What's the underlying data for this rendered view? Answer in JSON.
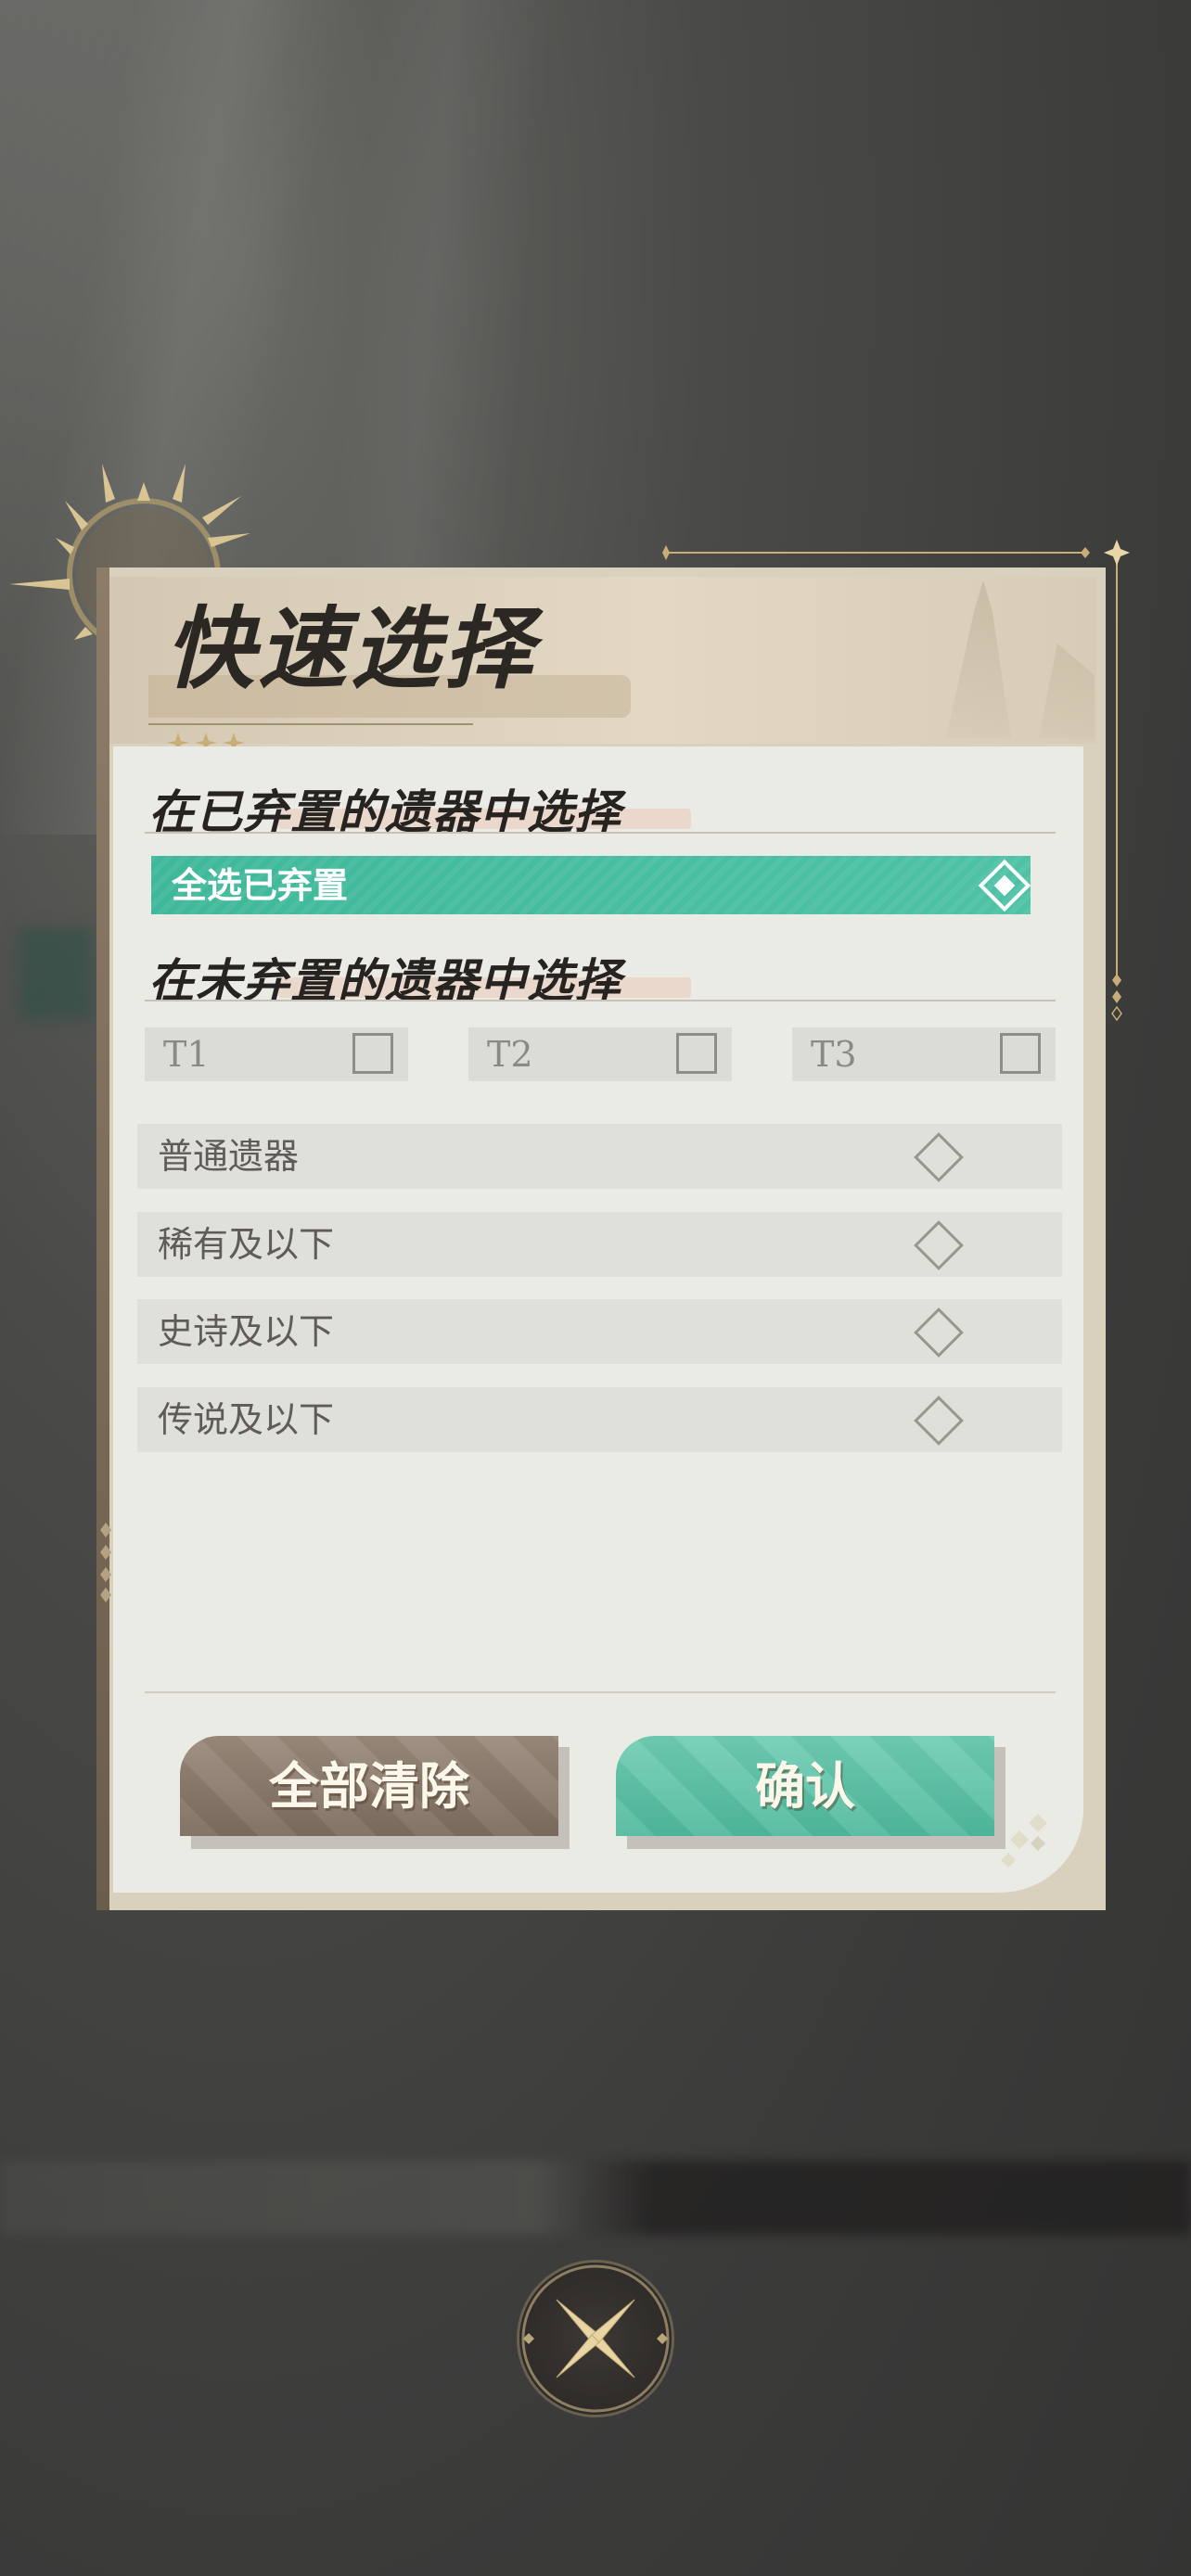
{
  "dialog": {
    "title": "快速选择",
    "discarded_section_title": "在已弃置的遗器中选择",
    "select_all_discarded_label": "全选已弃置",
    "non_discarded_section_title": "在未弃置的遗器中选择",
    "tiers": [
      {
        "label": "T1",
        "checked": false
      },
      {
        "label": "T2",
        "checked": false
      },
      {
        "label": "T3",
        "checked": false
      }
    ],
    "rarity_filters": [
      {
        "label": "普通遗器",
        "selected": false
      },
      {
        "label": "稀有及以下",
        "selected": false
      },
      {
        "label": "史诗及以下",
        "selected": false
      },
      {
        "label": "传说及以下",
        "selected": false
      }
    ],
    "clear_all_label": "全部清除",
    "confirm_label": "确认"
  },
  "icons": {
    "selected_diamond": "diamond-check-icon",
    "empty_diamond": "diamond-outline-icon",
    "close": "close-x-icon",
    "sun_emblem": "sun-emblem-icon"
  },
  "colors": {
    "accent_teal": "#4fc2a6",
    "clear_button": "#8b7b6e",
    "panel_bg": "#ebebe6",
    "gold_trim": "#c9ad78"
  }
}
